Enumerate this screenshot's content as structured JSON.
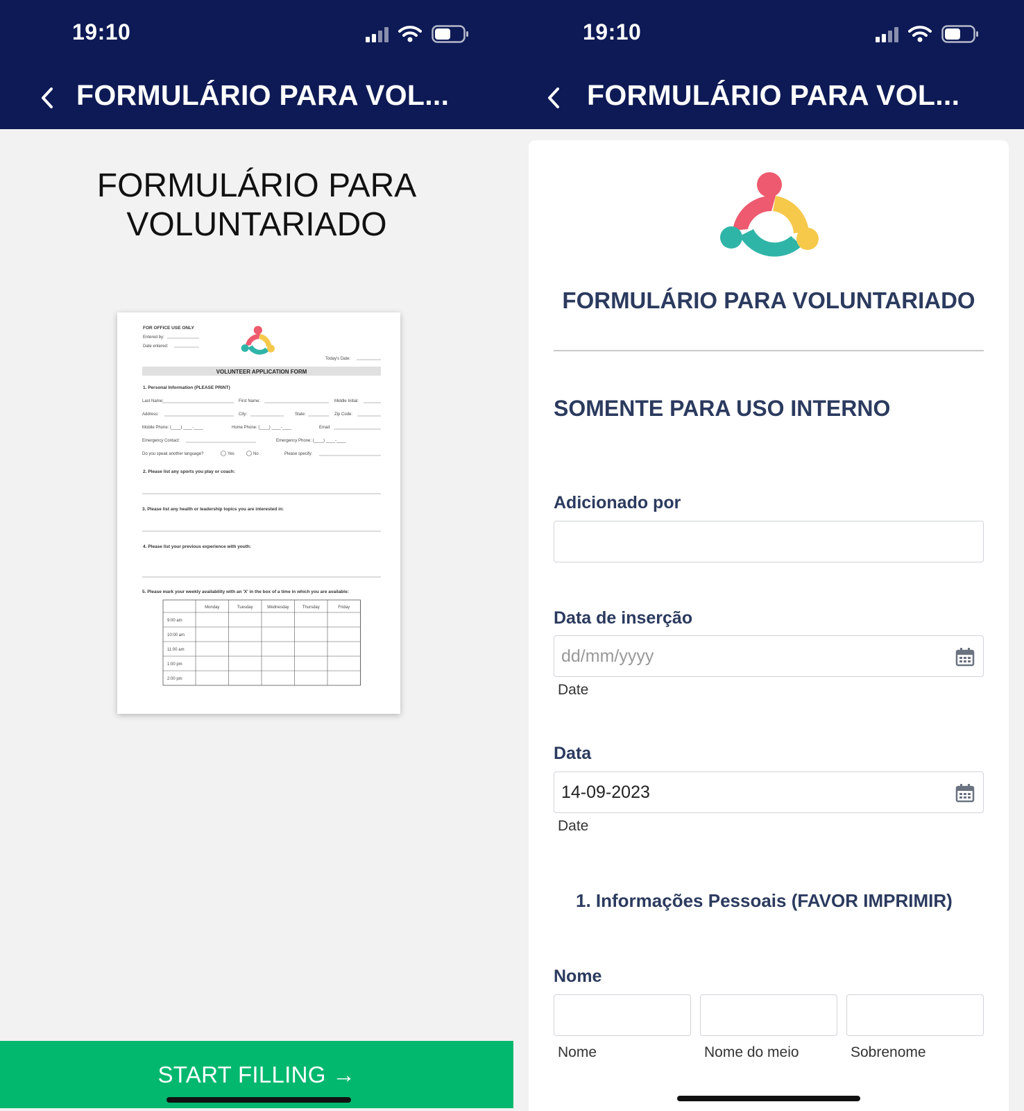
{
  "status_bar": {
    "time": "19:10"
  },
  "nav": {
    "title": "FORMULÁRIO PARA VOL..."
  },
  "left": {
    "heading_line1": "FORMULÁRIO PARA",
    "heading_line2": "VOLUNTARIADO",
    "start_button": "START FILLING →",
    "preview": {
      "office_use": "FOR OFFICE USE ONLY",
      "entered_by": "Entered by:",
      "date_entered": "Date entered:",
      "todays_date": "Today's Date:",
      "form_title": "VOLUNTEER APPLICATION FORM",
      "section1": "1. Personal Information (PLEASE PRINT)",
      "last_name": "Last Name:",
      "first_name": "First Name:",
      "middle_initial": "Middle Initial:",
      "address": "Address:",
      "city": "City:",
      "state": "State:",
      "zip": "Zip Code:",
      "mobile": "Mobile Phone: (____) ____-____",
      "home_phone": "Home Phone: (____) ____-____",
      "email": "Email:",
      "emergency_contact": "Emergency Contact:",
      "emergency_phone": "Emergency Phone: (____) ____-____",
      "language_q": "Do you speak another language?",
      "yes": "Yes",
      "no": "No",
      "please_specify": "Please specify:",
      "q2": "2. Please list any sports you play or coach:",
      "q3": "3. Please list any health or leadership topics you are interested in:",
      "q4": "4. Please list your previous experience with youth:",
      "q5": "5. Please mark your weekly availability with an 'X' in the box of a time in which you are available:",
      "days": [
        "Monday",
        "Tuesday",
        "Wednesday",
        "Thursday",
        "Friday"
      ],
      "times": [
        "9:00 am",
        "10:00 am",
        "11:00 am",
        "1:00 pm",
        "2:00 pm"
      ]
    }
  },
  "right": {
    "form_title": "FORMULÁRIO PARA VOLUNTARIADO",
    "section_internal": "SOMENTE PARA USO INTERNO",
    "added_by_label": "Adicionado por",
    "insert_date_label": "Data de inserção",
    "insert_date_placeholder": "dd/mm/yyyy",
    "date_sub": "Date",
    "date_label": "Data",
    "date_value": "14-09-2023",
    "personal_heading": "1. Informações Pessoais (FAVOR IMPRIMIR)",
    "name_label": "Nome",
    "name_sub_first": "Nome",
    "name_sub_middle": "Nome do meio",
    "name_sub_last": "Sobrenome"
  },
  "colors": {
    "navy": "#0d1a55",
    "green": "#02b86e",
    "label": "#2b3a5e"
  },
  "icons": [
    "back-chevron-icon",
    "signal-icon",
    "wifi-icon",
    "battery-icon",
    "calendar-icon",
    "arrow-right-icon"
  ]
}
